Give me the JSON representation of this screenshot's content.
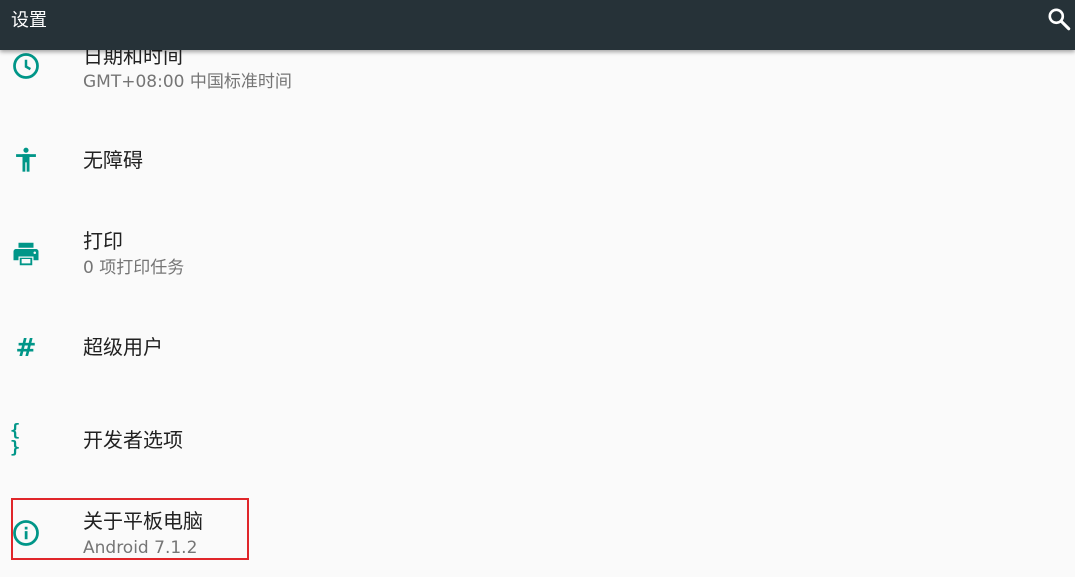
{
  "colors": {
    "toolbar_bg": "#263238",
    "accent": "#009688",
    "highlight": "#e0262a"
  },
  "toolbar": {
    "title": "设置",
    "search_icon": "search-icon"
  },
  "items": [
    {
      "title": "日期和时间",
      "summary": "GMT+08:00 中国标准时间",
      "icon": "clock-icon"
    },
    {
      "title": "无障碍",
      "summary": "",
      "icon": "accessibility-icon"
    },
    {
      "title": "打印",
      "summary": "0 项打印任务",
      "icon": "print-icon"
    },
    {
      "title": "超级用户",
      "summary": "",
      "icon": "hash-icon",
      "icon_glyph": "#"
    },
    {
      "title": "开发者选项",
      "summary": "",
      "icon": "code-braces-icon",
      "icon_glyph": "{ }"
    },
    {
      "title": "关于平板电脑",
      "summary": "Android 7.1.2",
      "icon": "info-icon"
    }
  ]
}
